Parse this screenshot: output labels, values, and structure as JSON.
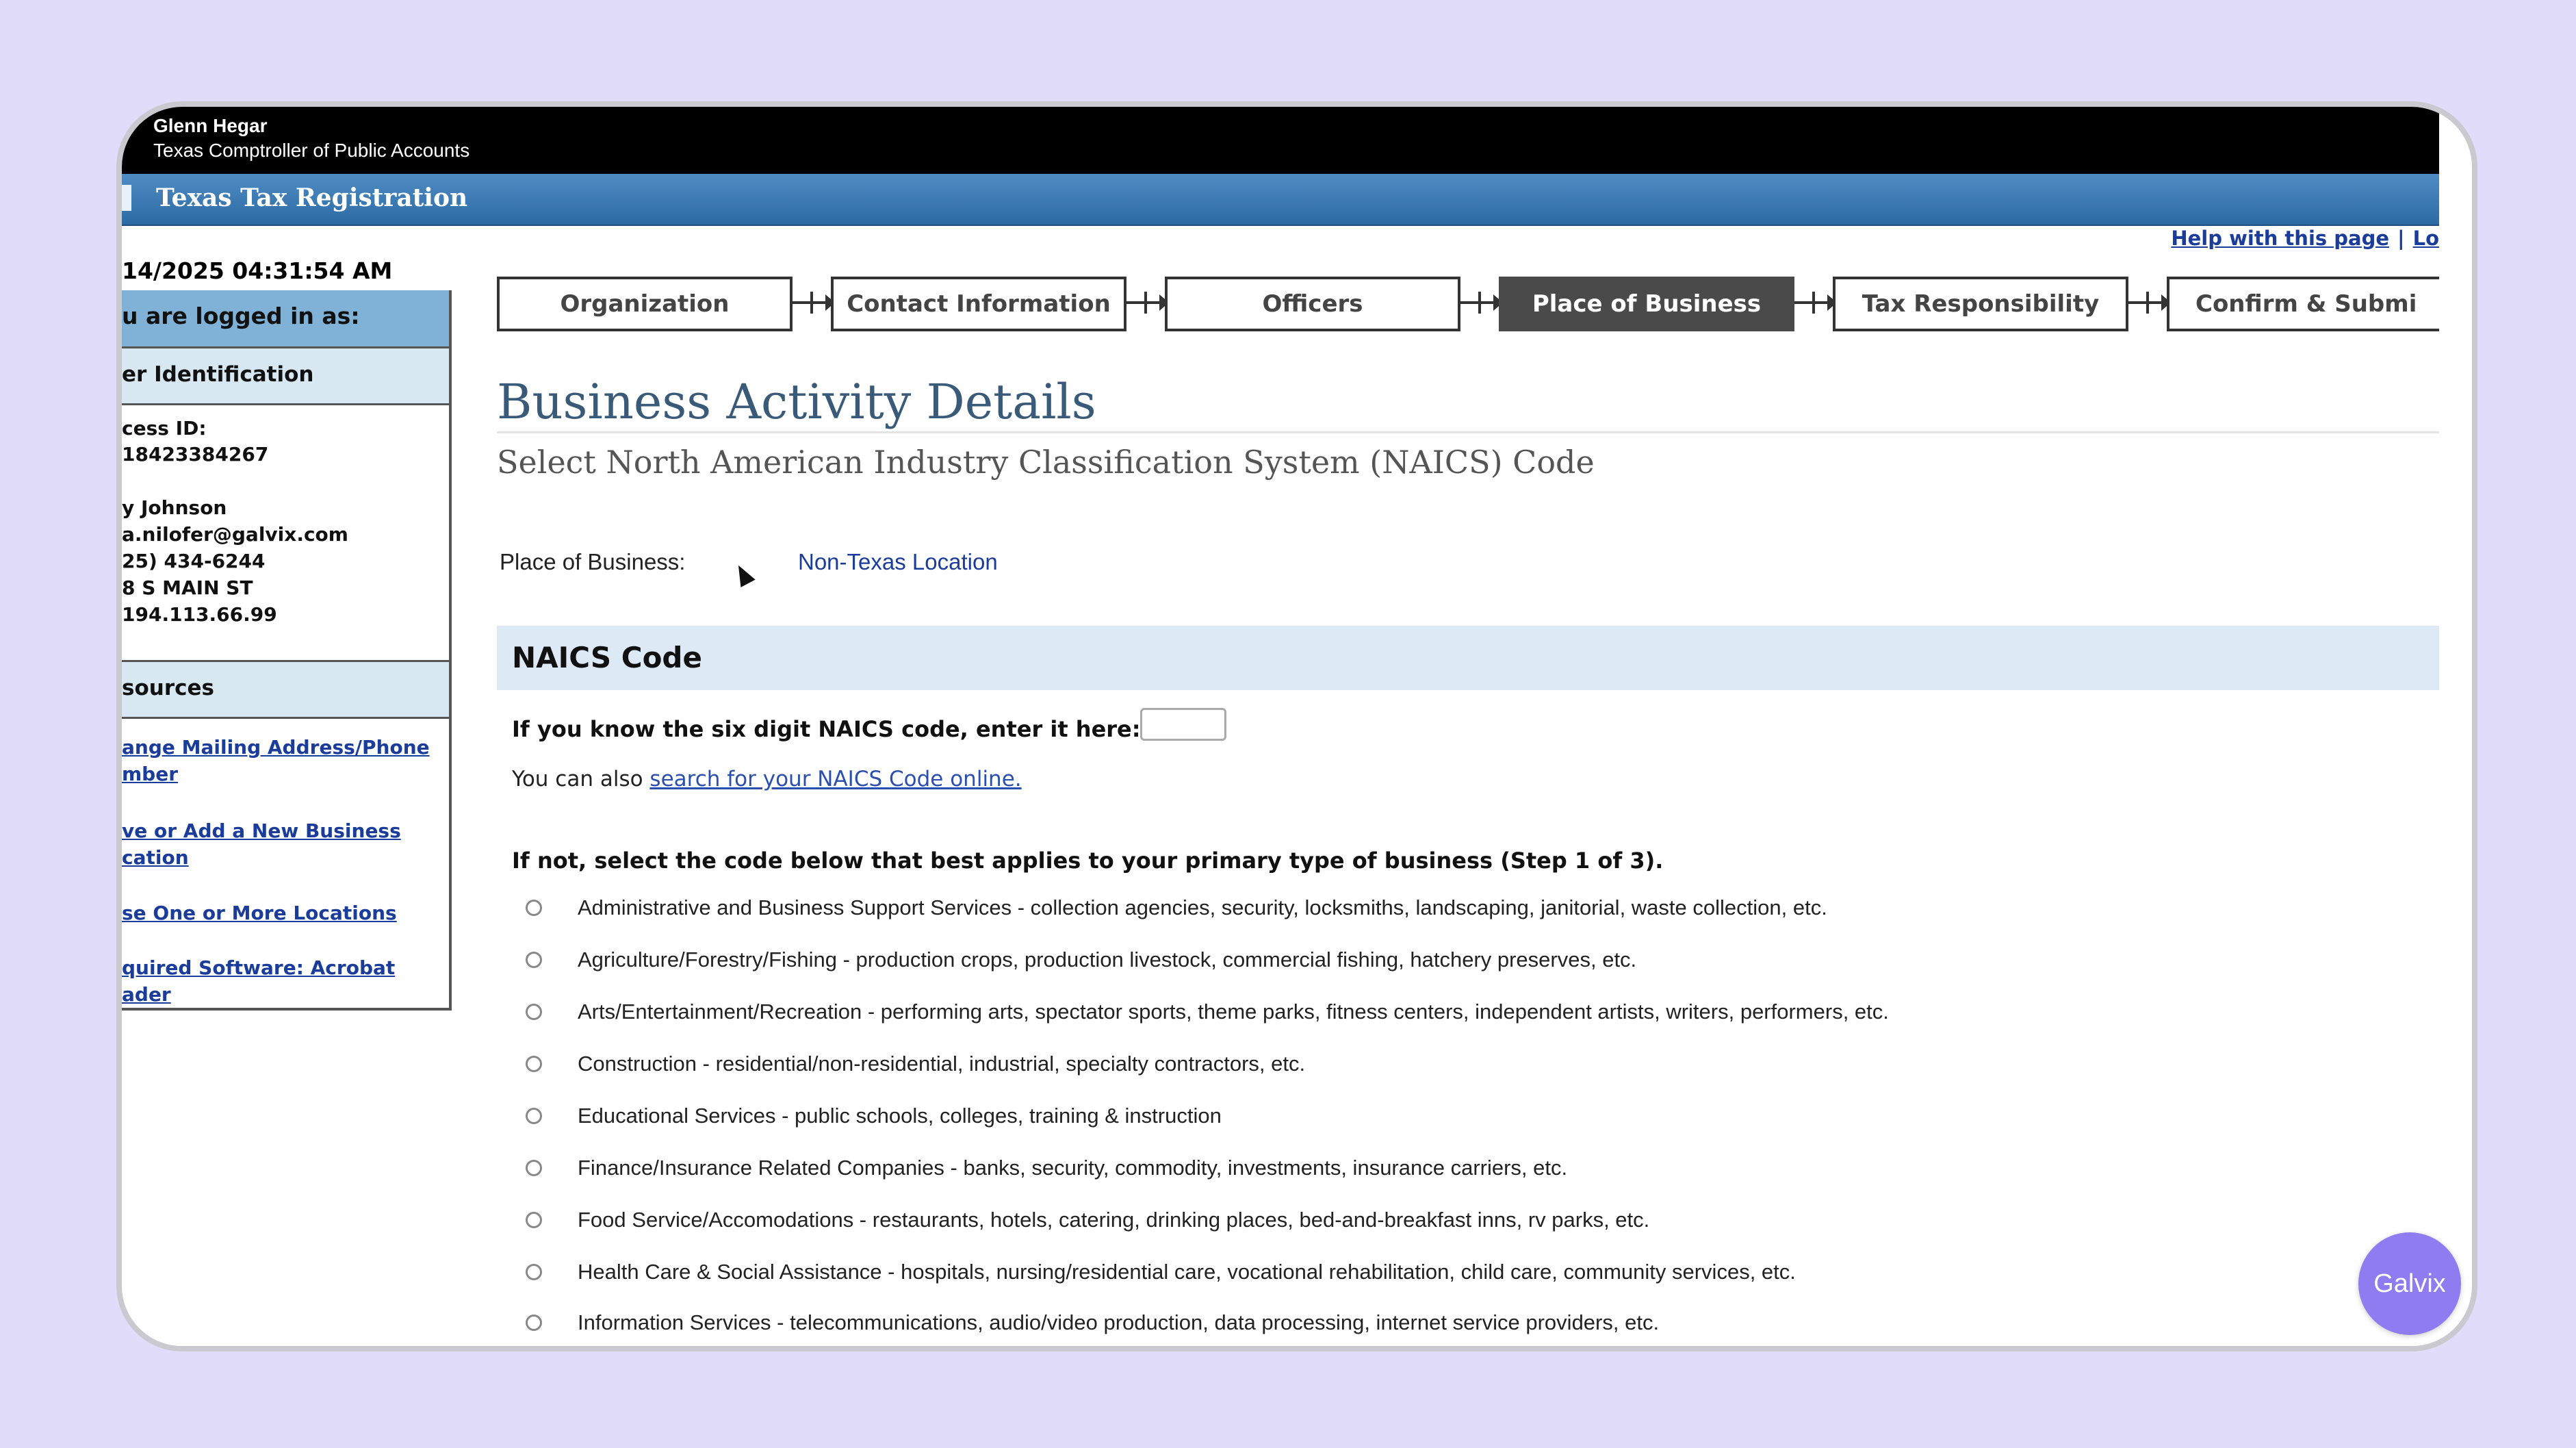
{
  "header": {
    "name": "Glenn Hegar",
    "org": "Texas Comptroller of Public Accounts",
    "app_title": "Texas Tax Registration"
  },
  "datetime": "14/2025 04:31:54 AM",
  "sidebar": {
    "logged_in_heading": "u are logged in as:",
    "identification_heading": "er Identification",
    "info": [
      "cess ID:",
      "18423384267",
      "",
      "y Johnson",
      "a.nilofer@galvix.com",
      "25) 434-6244",
      "8 S MAIN ST",
      " 194.113.66.99"
    ],
    "resources_heading": "sources",
    "links": [
      [
        "ange Mailing Address/Phone",
        "mber"
      ],
      [
        "ve or Add a New Business",
        "cation"
      ],
      [
        "se One or More Locations"
      ],
      [
        "quired Software: Acrobat",
        "ader"
      ]
    ]
  },
  "help": {
    "help_link": "Help with this page",
    "sep": "|",
    "logout_link": "Lo"
  },
  "steps": [
    {
      "label": "Organization",
      "active": false
    },
    {
      "label": "Contact Information",
      "active": false
    },
    {
      "label": "Officers",
      "active": false
    },
    {
      "label": "Place of Business",
      "active": true
    },
    {
      "label": "Tax Responsibility",
      "active": false
    },
    {
      "label": "Confirm & Submi",
      "active": false
    }
  ],
  "page": {
    "title": "Business Activity Details",
    "subtitle": "Select North American Industry Classification System (NAICS) Code",
    "pob_label": "Place of Business:",
    "pob_value": "Non-Texas Location"
  },
  "naics": {
    "section_title": "NAICS Code",
    "enter_prompt": "If you know the six digit NAICS code, enter it here:",
    "code_value": "",
    "also_prefix": "You can also ",
    "also_link": "search for your NAICS Code online.",
    "select_prompt": "If not, select the code below that best applies to your primary type of business (Step 1 of 3).",
    "options": [
      "Administrative and Business Support Services - collection agencies, security, locksmiths, landscaping, janitorial, waste collection, etc.",
      "Agriculture/Forestry/Fishing - production crops, production livestock, commercial fishing, hatchery preserves, etc.",
      "Arts/Entertainment/Recreation - performing arts, spectator sports, theme parks, fitness centers, independent artists, writers, performers, etc.",
      "Construction - residential/non-residential, industrial, specialty contractors, etc.",
      "Educational Services - public schools, colleges, training & instruction",
      "Finance/Insurance Related Companies - banks, security, commodity, investments, insurance carriers, etc.",
      "Food Service/Accomodations - restaurants, hotels, catering, drinking places, bed-and-breakfast inns, rv parks, etc.",
      "Health Care & Social Assistance - hospitals, nursing/residential care, vocational rehabilitation, child care, community services, etc.",
      "Information Services - telecommunications, audio/video production, data processing, internet service providers, etc."
    ]
  },
  "badge": {
    "label": "Galvix"
  },
  "colors": {
    "accent_blue": "#2c6aa4",
    "active_step": "#4a4a4a",
    "link": "#1a3c9a",
    "badge": "#8e7cf0"
  }
}
